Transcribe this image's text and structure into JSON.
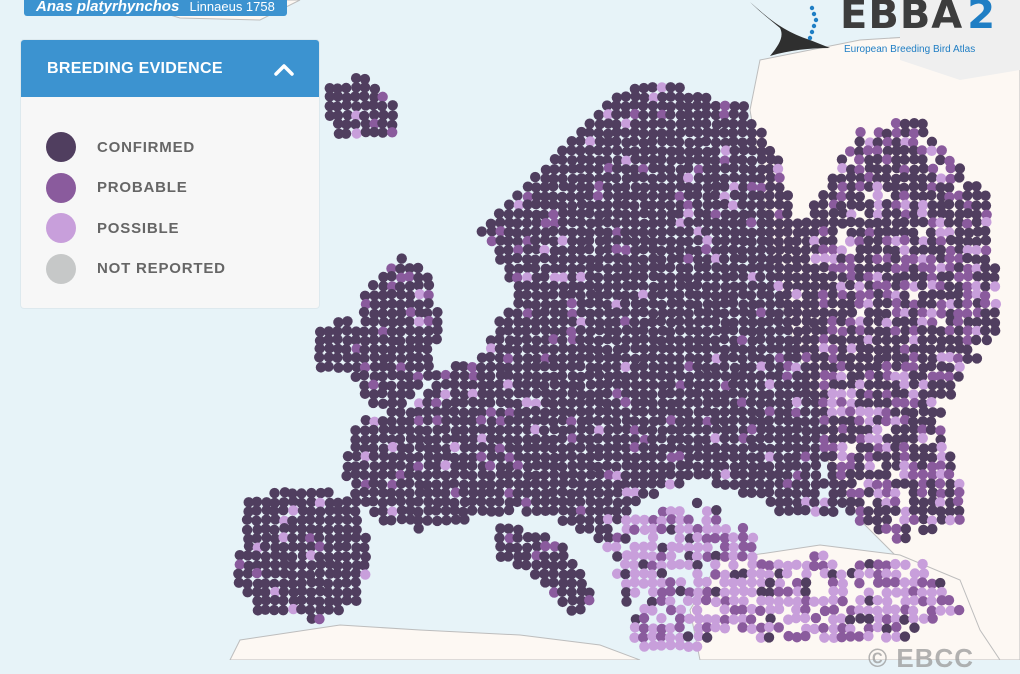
{
  "species": {
    "name": "Anas platyrhynchos",
    "author": "Linnaeus 1758"
  },
  "legend": {
    "title": "BREEDING EVIDENCE",
    "toggle_icon": "chevron-up-icon",
    "items": [
      {
        "label": "CONFIRMED",
        "color": "#503e5f"
      },
      {
        "label": "PROBABLE",
        "color": "#8a5b9d"
      },
      {
        "label": "POSSIBLE",
        "color": "#c89fdb"
      },
      {
        "label": "NOT REPORTED",
        "color": "#c6c8c8"
      }
    ]
  },
  "logo": {
    "text": "EBBA",
    "number": "2",
    "subtitle": "European Breeding Bird Atlas",
    "icon": "swift-bird-logo-icon"
  },
  "copyright": "© EBCC",
  "colors": {
    "sea": "#e7f3f8",
    "land": "#fdf8f3",
    "land_outside": "#efefef",
    "accent": "#3c93d0"
  }
}
